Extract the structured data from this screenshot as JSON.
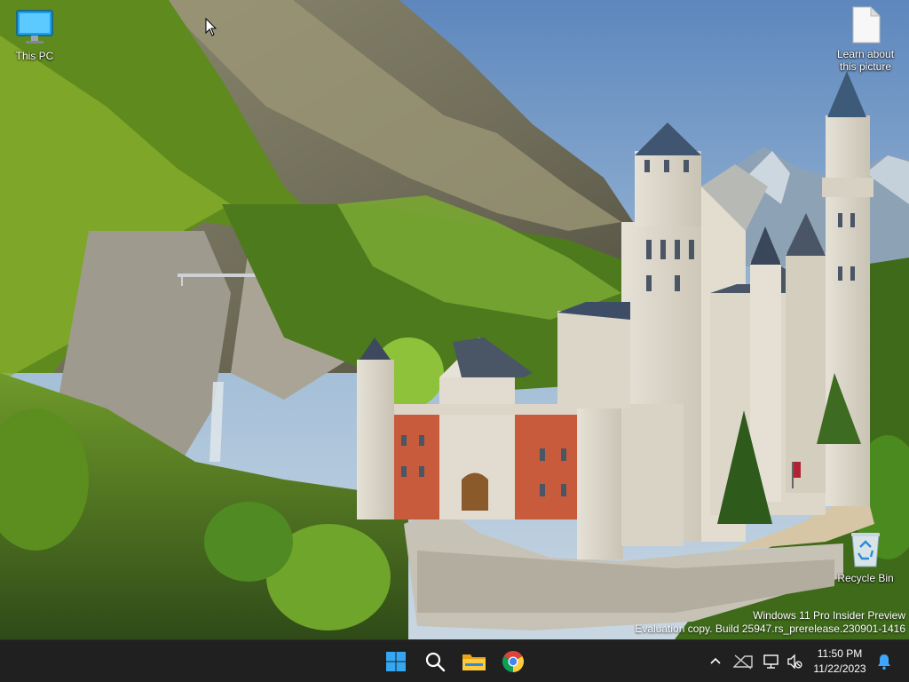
{
  "desktop": {
    "icons": [
      {
        "label": "This PC",
        "icon": "monitor-icon"
      },
      {
        "label": "Learn about this picture",
        "icon": "document-icon"
      },
      {
        "label": "Recycle Bin",
        "icon": "recycle-bin-icon"
      }
    ],
    "watermark": {
      "line1": "Windows 11 Pro Insider Preview",
      "line2": "Evaluation copy. Build 25947.rs_prerelease.230901-1416"
    }
  },
  "taskbar": {
    "apps": [
      {
        "name": "Start",
        "icon": "windows-logo-icon"
      },
      {
        "name": "Search",
        "icon": "search-icon"
      },
      {
        "name": "File Explorer",
        "icon": "folder-icon"
      },
      {
        "name": "Google Chrome",
        "icon": "chrome-icon"
      }
    ],
    "tray": {
      "time": "11:50 PM",
      "date": "11/22/2023"
    }
  },
  "colors": {
    "taskbar_bg": "#202020",
    "accent_blue": "#0a84d6",
    "sky": "#7fa4c9"
  }
}
